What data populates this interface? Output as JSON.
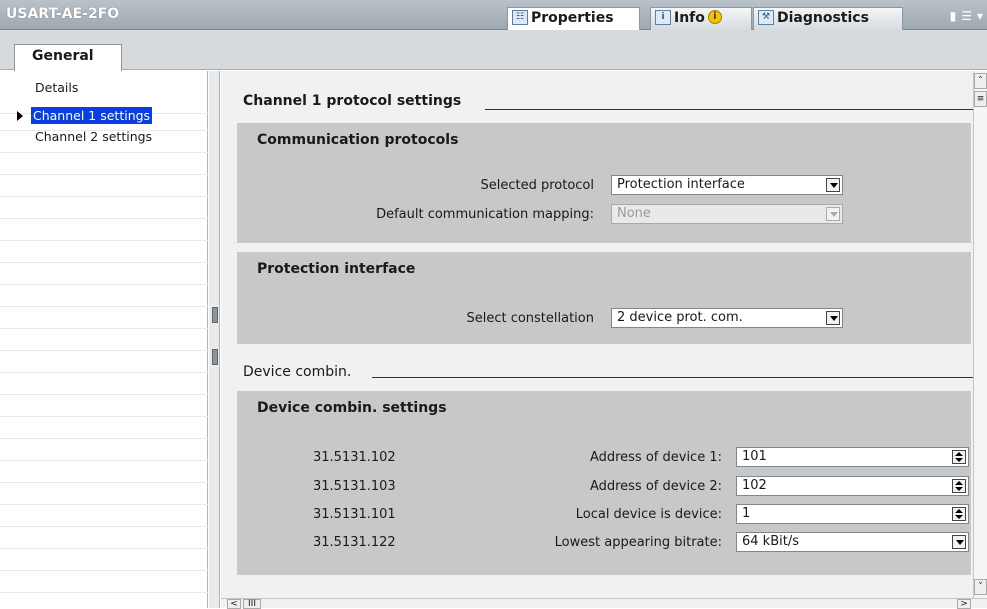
{
  "window": {
    "title": "USART-AE-2FO",
    "controls": [
      "restore-icon",
      "menu-icon",
      "dropdown-icon"
    ]
  },
  "panel_tabs": [
    {
      "label": "Properties",
      "icon": "properties-icon",
      "active": true
    },
    {
      "label": "Info",
      "icon": "info-icon",
      "badge": "i",
      "active": false
    },
    {
      "label": "Diagnostics",
      "icon": "diagnostics-icon",
      "active": false
    }
  ],
  "general_tab": {
    "label": "General"
  },
  "nav": {
    "items": [
      {
        "label": "Details",
        "selected": false
      },
      {
        "label": "Channel 1 settings",
        "selected": true
      },
      {
        "label": "Channel 2 settings",
        "selected": false
      }
    ]
  },
  "channel": {
    "heading": "Channel 1 protocol settings",
    "communication": {
      "title": "Communication protocols",
      "selected_protocol_label": "Selected protocol",
      "selected_protocol_value": "Protection interface",
      "default_mapping_label": "Default communication mapping:",
      "default_mapping_value": "None"
    },
    "protection": {
      "title": "Protection interface",
      "constellation_label": "Select constellation",
      "constellation_value": "2 device prot. com."
    },
    "device_combin_heading": "Device combin.",
    "device_settings": {
      "title": "Device combin. settings",
      "rows": [
        {
          "code": "31.5131.102",
          "label": "Address of device 1:",
          "value": "101",
          "control": "spinner"
        },
        {
          "code": "31.5131.103",
          "label": "Address of device 2:",
          "value": "102",
          "control": "spinner"
        },
        {
          "code": "31.5131.101",
          "label": "Local device is device:",
          "value": "1",
          "control": "spinner"
        },
        {
          "code": "31.5131.122",
          "label": "Lowest appearing bitrate:",
          "value": "64 kBit/s",
          "control": "dropdown"
        }
      ]
    }
  },
  "scrollbar": {
    "h_thumb_glyph": "III"
  }
}
